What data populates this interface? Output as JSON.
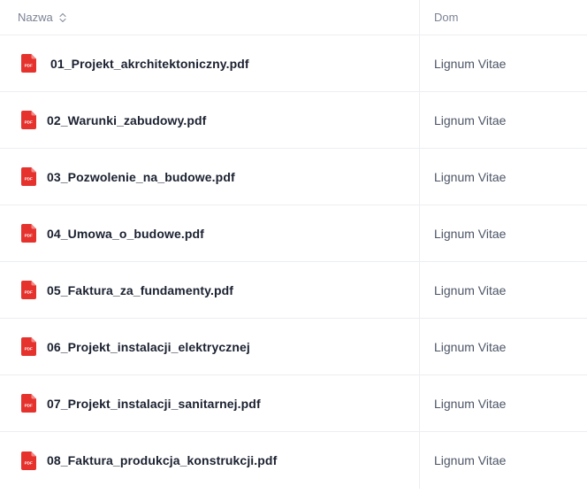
{
  "header": {
    "name_label": "Nazwa",
    "dom_label": "Dom"
  },
  "colors": {
    "pdf_icon": "#e5322d",
    "header_text": "#7b8394",
    "file_text": "#1b2130",
    "dom_text": "#4c5566",
    "divider": "#eceef2"
  },
  "icons": {
    "sort": "sort-updown-icon",
    "file": "pdf-file-icon"
  },
  "rows": [
    {
      "name": " 01_Projekt_akrchitektoniczny.pdf",
      "dom": "Lignum Vitae"
    },
    {
      "name": "02_Warunki_zabudowy.pdf",
      "dom": "Lignum Vitae"
    },
    {
      "name": "03_Pozwolenie_na_budowe.pdf",
      "dom": "Lignum Vitae"
    },
    {
      "name": "04_Umowa_o_budowe.pdf",
      "dom": "Lignum Vitae"
    },
    {
      "name": "05_Faktura_za_fundamenty.pdf",
      "dom": "Lignum Vitae"
    },
    {
      "name": "06_Projekt_instalacji_elektrycznej",
      "dom": "Lignum Vitae"
    },
    {
      "name": "07_Projekt_instalacji_sanitarnej.pdf",
      "dom": "Lignum Vitae"
    },
    {
      "name": "08_Faktura_produkcja_konstrukcji.pdf",
      "dom": "Lignum Vitae"
    }
  ]
}
